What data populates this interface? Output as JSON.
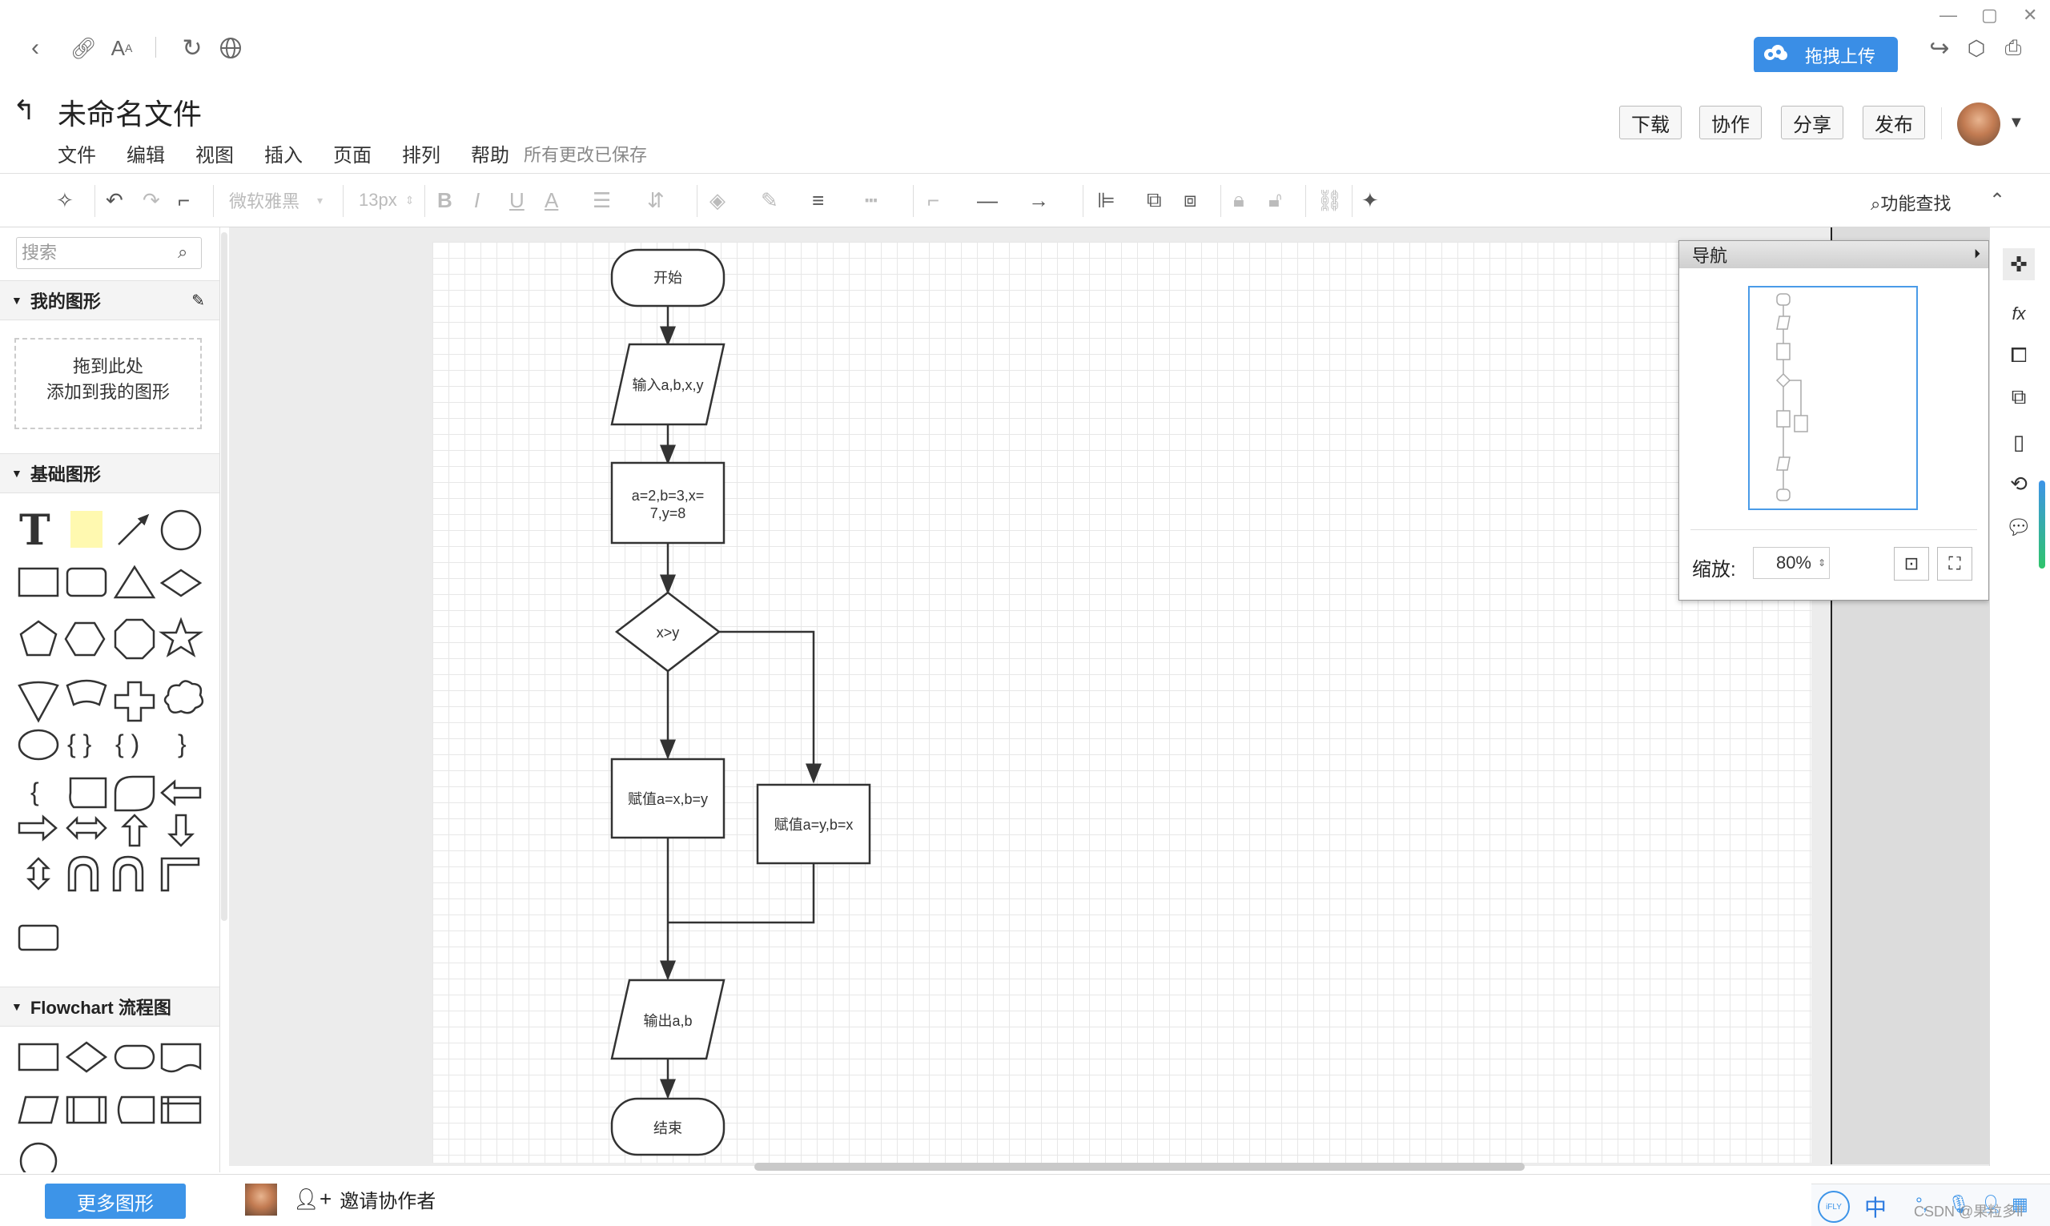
{
  "browser": {
    "upload_button": "拖拽上传",
    "window_controls": [
      "—",
      "▢",
      "✕"
    ]
  },
  "header": {
    "back_icon": "back-arrow-icon",
    "title": "未命名文件",
    "menu": [
      "文件",
      "编辑",
      "视图",
      "插入",
      "页面",
      "排列",
      "帮助"
    ],
    "save_status": "所有更改已保存",
    "buttons": {
      "download": "下载",
      "collaborate": "协作",
      "share": "分享",
      "publish": "发布"
    }
  },
  "toolbar": {
    "font_family": "微软雅黑",
    "font_size": "13px",
    "feature_search": "功能查找"
  },
  "sidebar": {
    "search_placeholder": "搜索",
    "my_shapes_title": "我的图形",
    "drop_hint_line1": "拖到此处",
    "drop_hint_line2": "添加到我的图形",
    "basic_shapes_title": "基础图形",
    "flowchart_title": "Flowchart 流程图",
    "more_shapes": "更多图形"
  },
  "flowchart": {
    "start": "开始",
    "input": "输入a,b,x,y",
    "assign_line1": "a=2,b=3,x=",
    "assign_line2": "7,y=8",
    "decision": "x>y",
    "branch_yes": "赋值a=x,b=y",
    "branch_no": "赋值a=y,b=x",
    "output": "输出a,b",
    "end": "结束"
  },
  "navigator": {
    "title": "导航",
    "zoom_label": "缩放:",
    "zoom_value": "80%"
  },
  "footer": {
    "invite": "邀请协作者",
    "ime_label": "中",
    "watermark": "CSDN @果粒多ll"
  },
  "colors": {
    "accent": "#3d94e8",
    "upload": "#3a8ee6",
    "stroke": "#333333"
  }
}
